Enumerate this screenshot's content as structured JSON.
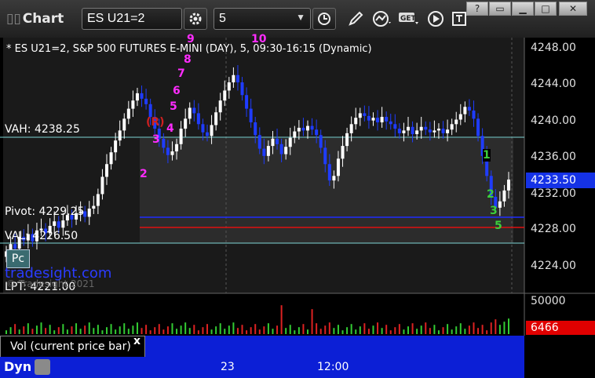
{
  "toolbar": {
    "title": "Chart",
    "symbol": "ES U21=2",
    "interval": "5"
  },
  "window_buttons": [
    "?",
    "restore",
    "minimize",
    "maximize",
    "close"
  ],
  "chart": {
    "header": "* ES U21=2, S&P 500 FUTURES E-MINI (DAY), 5, 09:30-16:15 (Dynamic)",
    "vah_label": "VAH: 4238.25",
    "pivot_label": "Pivot: 4229.25",
    "val_label": "VAL: 4226.50",
    "lpt_label": "LPT: 4221.00",
    "pc_badge": "Pc",
    "watermark": "tradesight.com",
    "copyright": "© Tradesight 2021",
    "price_axis": [
      "4248.00",
      "4244.00",
      "4240.00",
      "4236.00",
      "4232.00",
      "4228.00",
      "4224.00"
    ],
    "current_price": "4233.50",
    "volume_axis_top": "50000",
    "current_volume": "6466",
    "volume_tab_label": "Vol (current price bar)",
    "close_tab": "x",
    "time_axis": [
      "23",
      "12:00"
    ],
    "dyn_label": "Dyn",
    "wave_labels": [
      "9",
      "10",
      "8",
      "7",
      "6",
      "5",
      "4",
      "3",
      "2",
      "(R)",
      "1",
      "2",
      "3",
      "5"
    ],
    "colors": {
      "up_candle": "#ffffff",
      "down_candle": "#1f3cff",
      "vah_line": "#7fd6d6",
      "pivot_line": "#1e2cff",
      "lpt_line": "#e01010",
      "magenta": "#ff2cff",
      "current_price_bg": "#1532e6",
      "current_volume_bg": "#e00000",
      "plot_bg": "#2a2a2a"
    }
  },
  "chart_data": {
    "type": "candlestick",
    "title": "* ES U21=2, S&P 500 FUTURES E-MINI (DAY), 5, 09:30-16:15 (Dynamic)",
    "ylim": [
      4221,
      4249
    ],
    "y_ticks": [
      4248,
      4244,
      4240,
      4236,
      4232,
      4228,
      4224
    ],
    "levels": [
      {
        "name": "VAH",
        "value": 4238.25
      },
      {
        "name": "Pivot",
        "value": 4229.25
      },
      {
        "name": "VAL",
        "value": 4226.5
      },
      {
        "name": "LPT",
        "value": 4221.0
      }
    ],
    "close": [
      4225.6,
      4226.4,
      4225.9,
      4227.2,
      4226.8,
      4227.5,
      4226.7,
      4227.9,
      4228.1,
      4227.6,
      4228.4,
      4228.9,
      4228.2,
      4229.0,
      4229.6,
      4229.1,
      4229.8,
      4230.0,
      4229.4,
      4230.3,
      4230.6,
      4231.9,
      4233.8,
      4235.2,
      4236.5,
      4237.8,
      4238.9,
      4240.2,
      4241.3,
      4242.2,
      4243.0,
      4242.4,
      4241.8,
      4240.4,
      4239.1,
      4238.0,
      4237.0,
      4236.2,
      4236.6,
      4237.4,
      4239.1,
      4240.2,
      4241.4,
      4240.8,
      4239.6,
      4238.7,
      4238.3,
      4239.5,
      4240.9,
      4242.2,
      4243.3,
      4244.2,
      4245.0,
      4244.2,
      4242.8,
      4241.3,
      4239.8,
      4238.4,
      4236.9,
      4236.1,
      4237.2,
      4238.0,
      4237.4,
      4236.3,
      4237.1,
      4238.1,
      4238.8,
      4239.2,
      4238.9,
      4239.4,
      4239.0,
      4238.4,
      4237.0,
      4235.2,
      4233.4,
      4233.9,
      4235.8,
      4237.2,
      4238.6,
      4239.6,
      4240.3,
      4240.8,
      4240.5,
      4240.0,
      4240.3,
      4239.8,
      4240.4,
      4239.9,
      4239.6,
      4239.1,
      4238.6,
      4238.9,
      4239.3,
      4238.5,
      4238.9,
      4239.3,
      4239.0,
      4238.7,
      4238.9,
      4239.1,
      4238.6,
      4239.0,
      4239.6,
      4240.1,
      4240.7,
      4241.5,
      4241.1,
      4240.2,
      4238.3,
      4236.1,
      4233.9,
      4231.6,
      4230.4,
      4231.1,
      4232.3,
      4233.5
    ],
    "volume_axis_max": 50000,
    "last_volume": 6466,
    "x_tick_labels": [
      "23",
      "12:00"
    ]
  }
}
